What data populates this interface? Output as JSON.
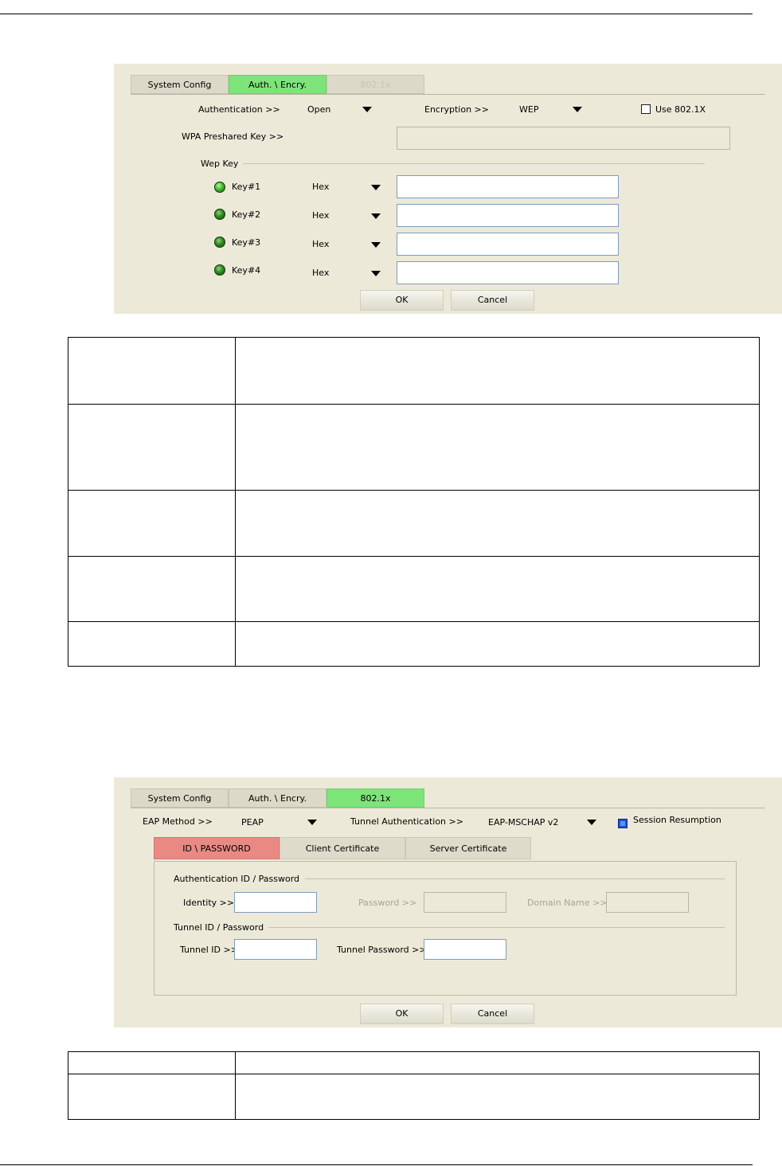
{
  "panel1": {
    "tabs": [
      {
        "label": "System Config"
      },
      {
        "label": "Auth. \\ Encry."
      },
      {
        "label": "802.1x"
      }
    ],
    "authentication_label": "Authentication >>",
    "authentication_value": "Open",
    "encryption_label": "Encryption >>",
    "encryption_value": "WEP",
    "use8021x_label": "Use 802.1X",
    "use8021x_checked": false,
    "wpa_psk_label": "WPA Preshared Key >>",
    "wpa_psk_value": "",
    "wep_key_group": "Wep Key",
    "keys": [
      {
        "label": "Key#1",
        "format": "Hex",
        "value": ""
      },
      {
        "label": "Key#2",
        "format": "Hex",
        "value": ""
      },
      {
        "label": "Key#3",
        "format": "Hex",
        "value": ""
      },
      {
        "label": "Key#4",
        "format": "Hex",
        "value": ""
      }
    ],
    "ok_label": "OK",
    "cancel_label": "Cancel"
  },
  "panel2": {
    "tabs": [
      {
        "label": "System Config"
      },
      {
        "label": "Auth. \\ Encry."
      },
      {
        "label": "802.1x"
      }
    ],
    "eap_method_label": "EAP Method >>",
    "eap_method_value": "PEAP",
    "tunnel_auth_label": "Tunnel Authentication >>",
    "tunnel_auth_value": "EAP-MSCHAP v2",
    "session_resumption_label": "Session Resumption",
    "session_resumption_checked": true,
    "subtabs": [
      {
        "label": "ID \\ PASSWORD"
      },
      {
        "label": "Client Certificate"
      },
      {
        "label": "Server Certificate"
      }
    ],
    "auth_group": "Authentication ID / Password",
    "identity_label": "Identity >>",
    "identity_value": "",
    "password_label": "Password >>",
    "domain_label": "Domain Name >>",
    "tunnel_group": "Tunnel ID / Password",
    "tunnel_id_label": "Tunnel ID >>",
    "tunnel_id_value": "",
    "tunnel_password_label": "Tunnel Password >>",
    "tunnel_password_value": "",
    "ok_label": "OK",
    "cancel_label": "Cancel"
  }
}
